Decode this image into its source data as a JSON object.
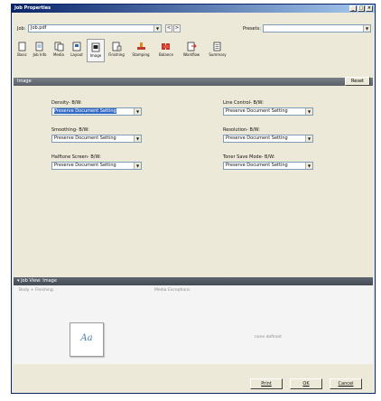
{
  "window": {
    "title": "Job Properties"
  },
  "job_row": {
    "job_label": "Job:",
    "job_value": "Job.pdf",
    "presets_label": "Presets:",
    "presets_value": ""
  },
  "toolbar": [
    {
      "label": "Basic",
      "icon": "page-icon"
    },
    {
      "label": "Job Info",
      "icon": "job-info-icon"
    },
    {
      "label": "Media",
      "icon": "media-icon"
    },
    {
      "label": "Layout",
      "icon": "layout-icon"
    },
    {
      "label": "Image",
      "icon": "image-icon",
      "active": true
    },
    {
      "label": "Finishing",
      "icon": "finishing-icon"
    },
    {
      "label": "Stamping",
      "icon": "stamping-icon"
    },
    {
      "label": "Balance",
      "icon": "balance-icon"
    },
    {
      "label": "Workflow",
      "icon": "workflow-icon"
    },
    {
      "label": "Summary",
      "icon": "summary-icon"
    }
  ],
  "image_section": {
    "title": "Image",
    "reset_label": "Reset",
    "settings": [
      {
        "label": "Density- B/W:",
        "value": "Preserve Document Setting",
        "selected": true
      },
      {
        "label": "Line Control- B/W:",
        "value": "Preserve Document Setting"
      },
      {
        "label": "Smoothing- B/W:",
        "value": "Preserve Document Setting"
      },
      {
        "label": "Resolution- B/W:",
        "value": "Preserve Document Setting"
      },
      {
        "label": "Halftone Screen- B/W:",
        "value": "Preserve Document Setting"
      },
      {
        "label": "Toner Save Mode- B/W:",
        "value": "Preserve Document Setting"
      }
    ]
  },
  "job_view": {
    "title": "Job View: Image",
    "col1": "Body + Finishing",
    "col2": "Media Exceptions",
    "thumb_text": "Aa",
    "none_defined": "none defined"
  },
  "buttons": {
    "print": "Print",
    "ok": "OK",
    "cancel": "Cancel"
  },
  "colors": {
    "accent": "#0a246a",
    "section_bar": "#5b6068",
    "selection": "#316ac5"
  }
}
